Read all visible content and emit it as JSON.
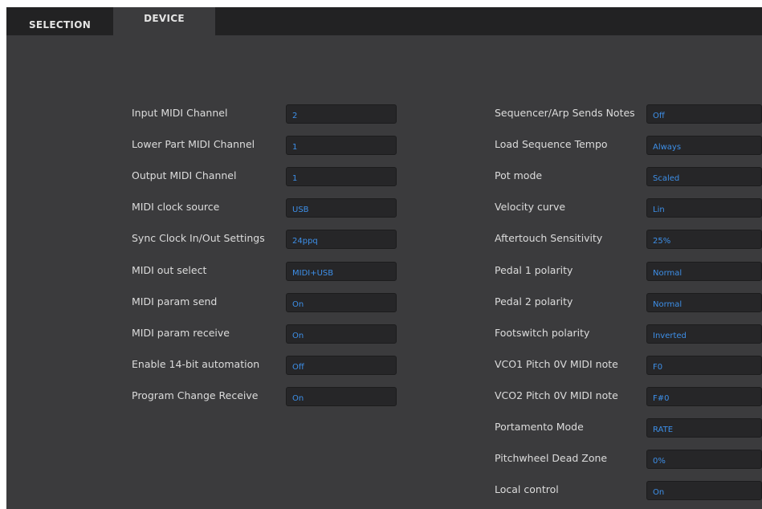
{
  "tabs": {
    "selection_label": "SELECTION",
    "device_label": "DEVICE"
  },
  "left_settings": [
    {
      "label": "Input MIDI Channel",
      "value": "2"
    },
    {
      "label": "Lower Part MIDI Channel",
      "value": "1"
    },
    {
      "label": "Output MIDI Channel",
      "value": "1"
    },
    {
      "label": "MIDI clock source",
      "value": "USB"
    },
    {
      "label": "Sync Clock In/Out Settings",
      "value": "24ppq"
    },
    {
      "label": "MIDI out select",
      "value": "MIDI+USB"
    },
    {
      "label": "MIDI param send",
      "value": "On"
    },
    {
      "label": "MIDI param receive",
      "value": "On"
    },
    {
      "label": "Enable 14-bit automation",
      "value": "Off"
    },
    {
      "label": "Program Change Receive",
      "value": "On"
    }
  ],
  "right_settings": [
    {
      "label": "Sequencer/Arp Sends Notes",
      "value": "Off"
    },
    {
      "label": "Load Sequence Tempo",
      "value": "Always"
    },
    {
      "label": "Pot mode",
      "value": "Scaled"
    },
    {
      "label": "Velocity curve",
      "value": "Lin"
    },
    {
      "label": "Aftertouch Sensitivity",
      "value": "25%"
    },
    {
      "label": "Pedal 1 polarity",
      "value": "Normal"
    },
    {
      "label": "Pedal 2 polarity",
      "value": "Normal"
    },
    {
      "label": "Footswitch polarity",
      "value": "Inverted"
    },
    {
      "label": "VCO1 Pitch 0V MIDI note",
      "value": "F0"
    },
    {
      "label": "VCO2 Pitch 0V MIDI note",
      "value": "F#0"
    },
    {
      "label": "Portamento Mode",
      "value": "RATE"
    },
    {
      "label": "Pitchwheel Dead Zone",
      "value": "0%"
    },
    {
      "label": "Local control",
      "value": "On"
    }
  ],
  "colors": {
    "panel_background": "#3b3b3d",
    "tab_bar": "#222223",
    "field_background": "#262628",
    "value_text": "#3d8fe8",
    "label_text": "#dcdcdc"
  }
}
